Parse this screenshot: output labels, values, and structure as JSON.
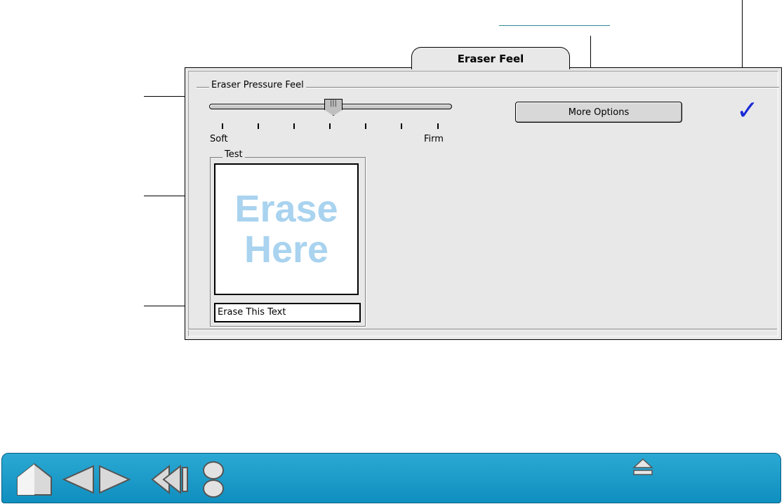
{
  "tab": {
    "label": "Eraser Feel"
  },
  "pressure_group": {
    "title": "Eraser Pressure Feel",
    "soft_label": "Soft",
    "firm_label": "Firm",
    "slider_value_fraction": 0.5
  },
  "more_options": {
    "label": "More Options"
  },
  "test_group": {
    "title": "Test",
    "erase_line1": "Erase",
    "erase_line2": "Here",
    "erase_field_text": "Erase This Text"
  },
  "colors": {
    "erase_text": "#a9d3ef",
    "checkmark": "#1a2bd8",
    "navbar": "#1a9fcc"
  },
  "navbar": {
    "icons": [
      "home-icon",
      "previous-page-icon",
      "next-page-icon",
      "back-icon",
      "contents-index-icon",
      "eject-icon"
    ]
  }
}
